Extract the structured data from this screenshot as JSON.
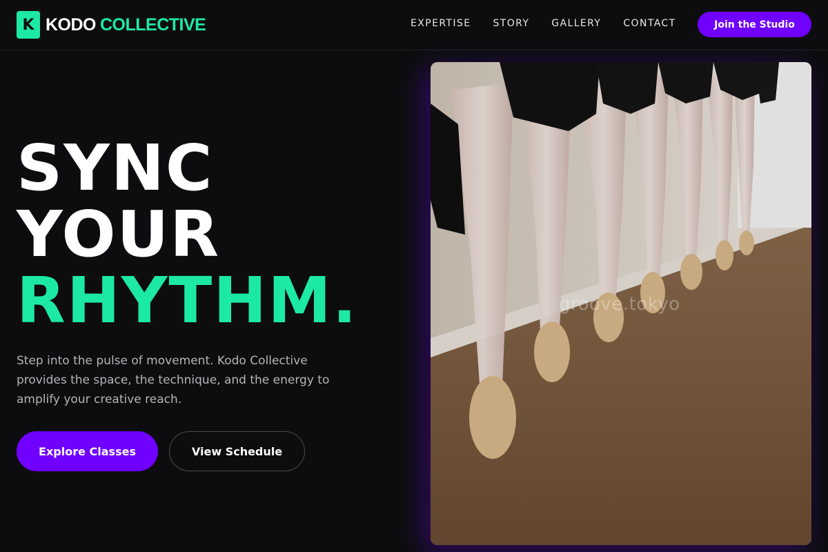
{
  "brand": {
    "mark": "K",
    "name_part1": "KODO",
    "name_part2": "COLLECTIVE",
    "accent_color": "#1de9a6",
    "primary_color": "#7000ff"
  },
  "nav": {
    "items": [
      {
        "label": "EXPERTISE"
      },
      {
        "label": "STORY"
      },
      {
        "label": "GALLERY"
      },
      {
        "label": "CONTACT"
      }
    ],
    "cta_label": "Join the Studio"
  },
  "hero": {
    "line1": "SYNC",
    "line2": "YOUR",
    "line3": "RHYTHM.",
    "description": "Step into the pulse of movement. Kodo Collective provides the space, the technique, and the energy to amplify your creative reach.",
    "primary_button": "Explore Classes",
    "secondary_button": "View Schedule"
  },
  "image": {
    "subject": "dancers-legs-en-pointe-at-barre",
    "watermark": "groove.tokyo"
  }
}
